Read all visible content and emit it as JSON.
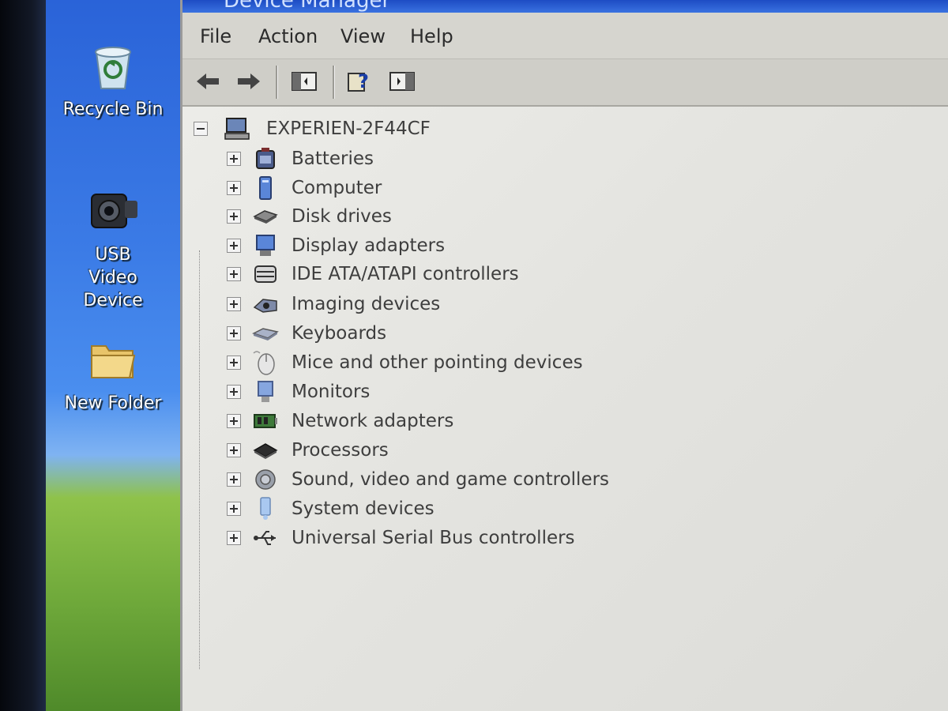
{
  "desktop": {
    "icons": [
      {
        "label": "Recycle Bin",
        "icon": "recycle-bin-icon"
      },
      {
        "label": "USB Video Device",
        "icon": "webcam-icon"
      },
      {
        "label": "New Folder",
        "icon": "folder-icon"
      }
    ]
  },
  "window": {
    "title": "Device Manager",
    "menu": [
      "File",
      "Action",
      "View",
      "Help"
    ],
    "toolbar": [
      "back-arrow-icon",
      "forward-arrow-icon",
      "show-hide-console-tree-icon",
      "help-icon",
      "properties-pane-icon"
    ]
  },
  "tree": {
    "root": {
      "label": "EXPERIEN-2F44CF",
      "icon": "computer-icon",
      "expanded": true
    },
    "categories": [
      {
        "label": "Batteries",
        "icon": "battery-icon"
      },
      {
        "label": "Computer",
        "icon": "computer-icon"
      },
      {
        "label": "Disk drives",
        "icon": "disk-drive-icon"
      },
      {
        "label": "Display adapters",
        "icon": "display-adapter-icon"
      },
      {
        "label": "IDE ATA/ATAPI controllers",
        "icon": "ide-controller-icon"
      },
      {
        "label": "Imaging devices",
        "icon": "camera-icon"
      },
      {
        "label": "Keyboards",
        "icon": "keyboard-icon"
      },
      {
        "label": "Mice and other pointing devices",
        "icon": "mouse-icon"
      },
      {
        "label": "Monitors",
        "icon": "monitor-icon"
      },
      {
        "label": "Network adapters",
        "icon": "network-card-icon"
      },
      {
        "label": "Processors",
        "icon": "processor-icon"
      },
      {
        "label": "Sound, video and game controllers",
        "icon": "speaker-icon"
      },
      {
        "label": "System devices",
        "icon": "system-device-icon"
      },
      {
        "label": "Universal Serial Bus controllers",
        "icon": "usb-icon"
      }
    ]
  }
}
